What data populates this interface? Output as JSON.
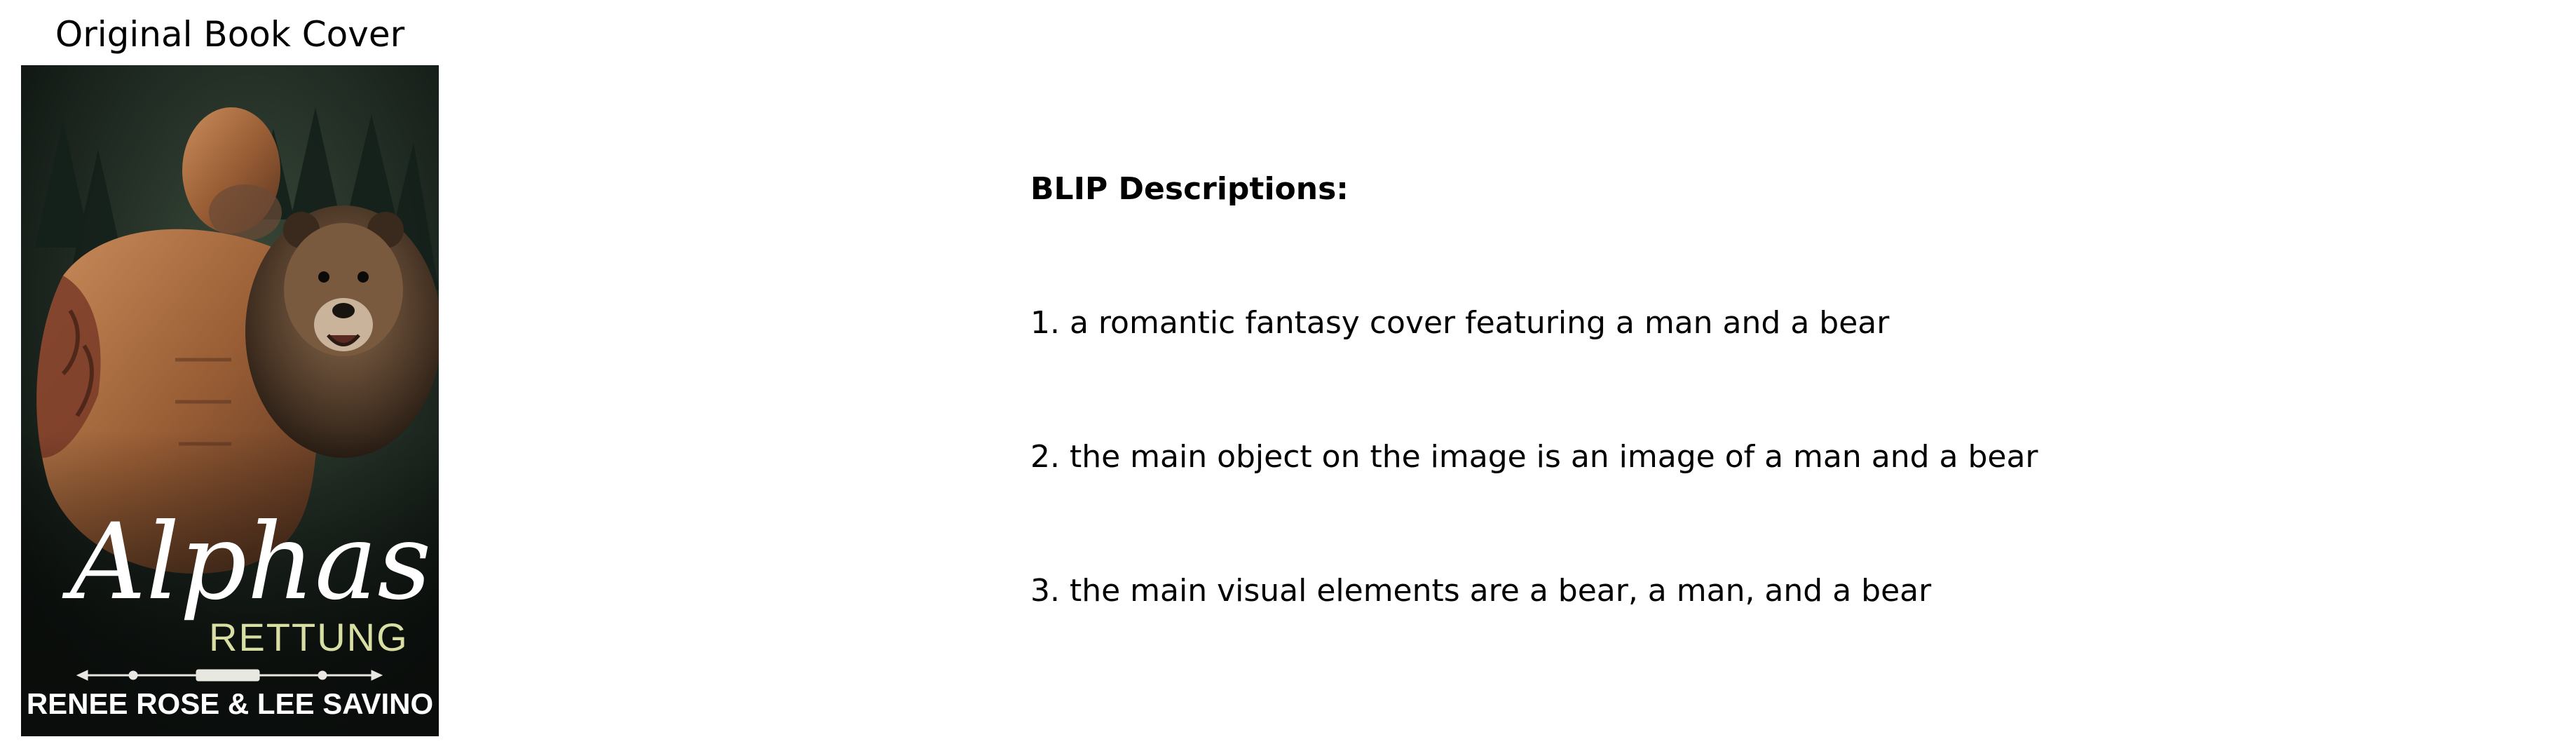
{
  "cover_panel": {
    "title": "Original Book Cover",
    "book": {
      "title_script": "Alphas",
      "subtitle": "RETTUNG",
      "authors": "RENEE ROSE & LEE SAVINO"
    },
    "colors": {
      "background": "#1a231c",
      "subtitle": "#d9dfa2",
      "title": "#ffffff"
    }
  },
  "descriptions": {
    "heading": "BLIP Descriptions:",
    "items": [
      "1. a romantic fantasy cover featuring a man and a bear",
      "2. the main object on the image is an image of a man and a bear",
      "3. the main visual elements are a bear, a man, and a bear"
    ]
  }
}
